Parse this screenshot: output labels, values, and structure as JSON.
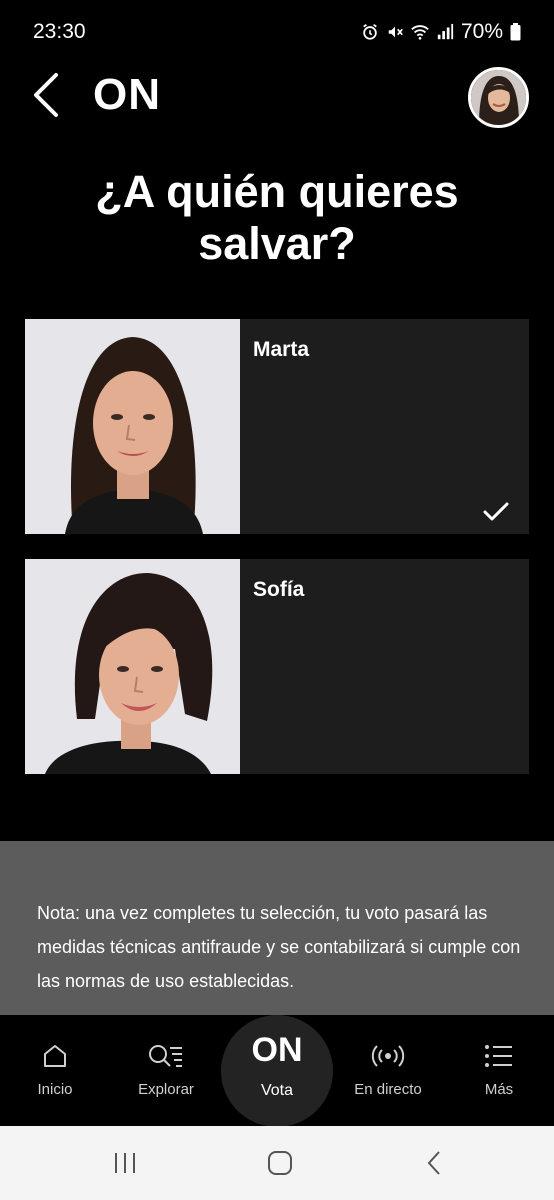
{
  "status_bar": {
    "time": "23:30",
    "battery": "70%",
    "icons": [
      "alarm-icon",
      "mute-icon",
      "wifi-icon",
      "signal-icon",
      "battery-icon"
    ]
  },
  "header": {
    "title": "ON",
    "back_icon": "chevron-left-icon",
    "avatar_icon": "user-avatar"
  },
  "question": {
    "line1": "¿A quién quieres",
    "line2": "salvar?"
  },
  "candidates": [
    {
      "name": "Marta",
      "selected": true
    },
    {
      "name": "Sofía",
      "selected": false
    }
  ],
  "note": {
    "text": "Nota: una vez completes tu selección, tu voto pasará las medidas técnicas antifraude y se contabilizará si cumple con las normas de uso establecidas."
  },
  "bottom_nav": {
    "items": [
      {
        "label": "Inicio",
        "icon": "home-icon"
      },
      {
        "label": "Explorar",
        "icon": "explore-icon"
      },
      {
        "label": "Vota",
        "icon": "on-logo",
        "logo": "ON"
      },
      {
        "label": "En directo",
        "icon": "live-icon"
      },
      {
        "label": "Más",
        "icon": "menu-icon"
      }
    ]
  },
  "system_nav": {
    "buttons": [
      "recents-icon",
      "home-button-icon",
      "back-icon"
    ]
  },
  "colors": {
    "background": "#000000",
    "card": "#1d1d1d",
    "note_bg": "#5c5c5c",
    "system_nav_bg": "#f4f4f4"
  }
}
